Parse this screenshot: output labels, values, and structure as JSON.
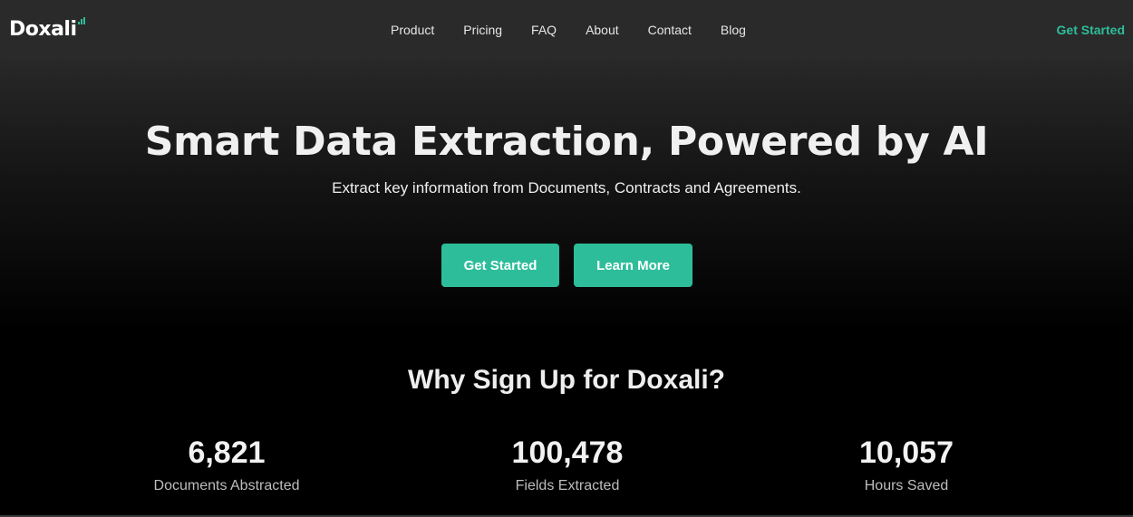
{
  "header": {
    "logo_text": "Doxali",
    "nav": [
      {
        "label": "Product"
      },
      {
        "label": "Pricing"
      },
      {
        "label": "FAQ"
      },
      {
        "label": "About"
      },
      {
        "label": "Contact"
      },
      {
        "label": "Blog"
      }
    ],
    "cta_label": "Get Started"
  },
  "hero": {
    "title": "Smart Data Extraction, Powered by AI",
    "subtitle": "Extract key information from Documents, Contracts and Agreements.",
    "primary_button": "Get Started",
    "secondary_button": "Learn More"
  },
  "why": {
    "title": "Why Sign Up for Doxali?",
    "stats": [
      {
        "value": "6,821",
        "label": "Documents Abstracted"
      },
      {
        "value": "100,478",
        "label": "Fields Extracted"
      },
      {
        "value": "10,057",
        "label": "Hours Saved"
      }
    ]
  },
  "colors": {
    "accent": "#2ebd9b",
    "header_bg": "#2a2a2a",
    "page_bg": "#000000"
  },
  "icons": {
    "logo_mark": "chart-bars-icon"
  }
}
